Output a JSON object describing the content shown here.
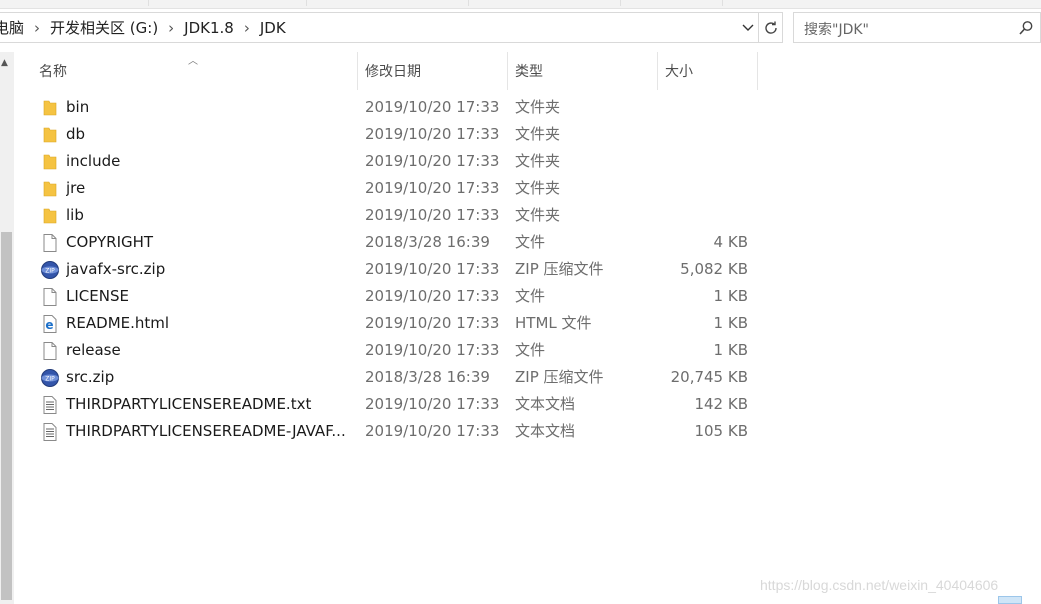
{
  "breadcrumb": {
    "items": [
      "电脑",
      "开发相关区 (G:)",
      "JDK1.8",
      "JDK"
    ],
    "separator": "›"
  },
  "search": {
    "placeholder": "搜索\"JDK\""
  },
  "columns": {
    "name": "名称",
    "date": "修改日期",
    "type": "类型",
    "size": "大小"
  },
  "files": [
    {
      "name": "bin",
      "date": "2019/10/20 17:33",
      "type": "文件夹",
      "size": "",
      "icon": "folder-icon"
    },
    {
      "name": "db",
      "date": "2019/10/20 17:33",
      "type": "文件夹",
      "size": "",
      "icon": "folder-icon"
    },
    {
      "name": "include",
      "date": "2019/10/20 17:33",
      "type": "文件夹",
      "size": "",
      "icon": "folder-icon"
    },
    {
      "name": "jre",
      "date": "2019/10/20 17:33",
      "type": "文件夹",
      "size": "",
      "icon": "folder-icon"
    },
    {
      "name": "lib",
      "date": "2019/10/20 17:33",
      "type": "文件夹",
      "size": "",
      "icon": "folder-icon"
    },
    {
      "name": "COPYRIGHT",
      "date": "2018/3/28 16:39",
      "type": "文件",
      "size": "4 KB",
      "icon": "file-icon"
    },
    {
      "name": "javafx-src.zip",
      "date": "2019/10/20 17:33",
      "type": "ZIP 压缩文件",
      "size": "5,082 KB",
      "icon": "zip-icon"
    },
    {
      "name": "LICENSE",
      "date": "2019/10/20 17:33",
      "type": "文件",
      "size": "1 KB",
      "icon": "file-icon"
    },
    {
      "name": "README.html",
      "date": "2019/10/20 17:33",
      "type": "HTML 文件",
      "size": "1 KB",
      "icon": "html-file-icon"
    },
    {
      "name": "release",
      "date": "2019/10/20 17:33",
      "type": "文件",
      "size": "1 KB",
      "icon": "file-icon"
    },
    {
      "name": "src.zip",
      "date": "2018/3/28 16:39",
      "type": "ZIP 压缩文件",
      "size": "20,745 KB",
      "icon": "zip-icon"
    },
    {
      "name": "THIRDPARTYLICENSEREADME.txt",
      "date": "2019/10/20 17:33",
      "type": "文本文档",
      "size": "142 KB",
      "icon": "text-file-icon"
    },
    {
      "name": "THIRDPARTYLICENSEREADME-JAVAF...",
      "date": "2019/10/20 17:33",
      "type": "文本文档",
      "size": "105 KB",
      "icon": "text-file-icon"
    }
  ],
  "watermark": "https://blog.csdn.net/weixin_40404606",
  "colors": {
    "folder": "#f5c342",
    "zip": "#3355aa",
    "html_icon": "#1b6fc9"
  }
}
